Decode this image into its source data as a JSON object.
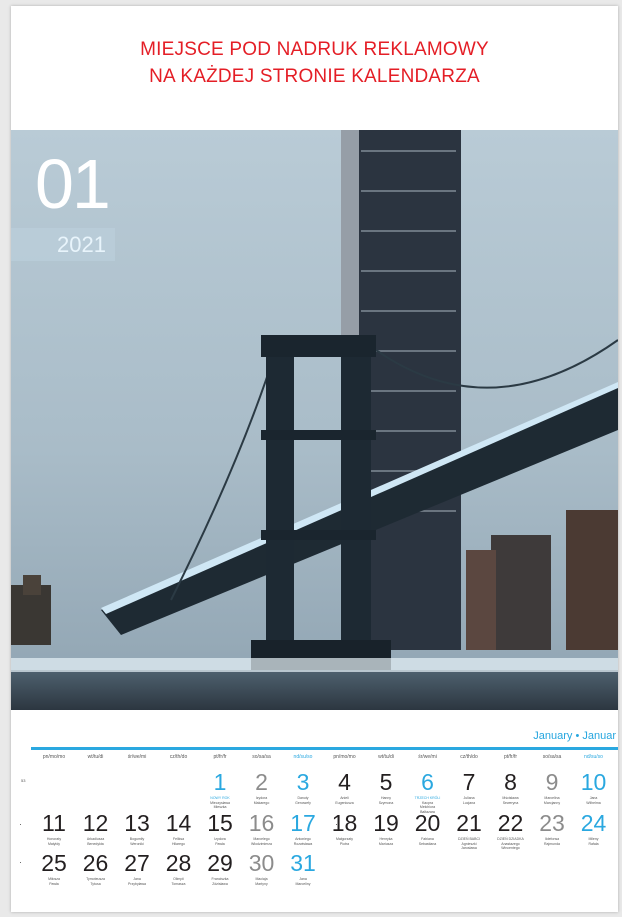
{
  "ad_text": {
    "line1": "MIEJSCE POD NADRUK REKLAMOWY",
    "line2": "NA KAŻDEJ STRONIE KALENDARZA"
  },
  "month_number": "01",
  "year": "2021",
  "month_name": "January • Januar",
  "weekday_headers": [
    "pn/mo/mo",
    "wt/tu/di",
    "śr/we/mi",
    "cz/th/do",
    "pt/fr/fr",
    "so/sa/sa",
    "nd/su/so",
    "pn/mo/mo",
    "wt/tu/di",
    "śr/we/mi",
    "cz/th/do",
    "pt/fr/fr",
    "so/sa/sa",
    "nd/su/so"
  ],
  "week_number": "53",
  "days": [
    {
      "n": "1",
      "names": [
        "NOWY ROK",
        "Mieczysława",
        "Mieszka"
      ],
      "holiday": true
    },
    {
      "n": "2",
      "names": [
        "Izydora",
        "Makarego"
      ]
    },
    {
      "n": "3",
      "names": [
        "Danuty",
        "Genowefy"
      ]
    },
    {
      "n": "4",
      "names": [
        "Anieli",
        "Eugeniusza"
      ]
    },
    {
      "n": "5",
      "names": [
        "Hanny",
        "Szymona"
      ]
    },
    {
      "n": "6",
      "names": [
        "TRZECH KRÓLI",
        "Kacpra",
        "Melchiora",
        "Baltazara"
      ],
      "holiday": true
    },
    {
      "n": "7",
      "names": [
        "Juliana",
        "Lucjana"
      ]
    },
    {
      "n": "8",
      "names": [
        "Mścisława",
        "Seweryna"
      ]
    },
    {
      "n": "9",
      "names": [
        "Marcelina",
        "Marcjanny"
      ]
    },
    {
      "n": "10",
      "names": [
        "Jana",
        "Wilhelma"
      ]
    },
    {
      "n": "11",
      "names": [
        "Honoraty",
        "Matyldy"
      ]
    },
    {
      "n": "12",
      "names": [
        "Arkadiusza",
        "Benedykta"
      ]
    },
    {
      "n": "13",
      "names": [
        "Bogumiły",
        "Weroniki"
      ]
    },
    {
      "n": "14",
      "names": [
        "Feliksa",
        "Hilarego"
      ]
    },
    {
      "n": "15",
      "names": [
        "Izydora",
        "Pawła"
      ]
    },
    {
      "n": "16",
      "names": [
        "Marcelego",
        "Włodzimierza"
      ]
    },
    {
      "n": "17",
      "names": [
        "Antoniego",
        "Rozwisława"
      ]
    },
    {
      "n": "18",
      "names": [
        "Małgorzaty",
        "Piotra"
      ]
    },
    {
      "n": "19",
      "names": [
        "Henryka",
        "Mariusza"
      ]
    },
    {
      "n": "20",
      "names": [
        "Fabiana",
        "Sebastiana"
      ]
    },
    {
      "n": "21",
      "names": [
        "DZIEŃ BABCI",
        "Agnieszki",
        "Jarosława"
      ]
    },
    {
      "n": "22",
      "names": [
        "DZIEŃ DZIADKA",
        "Anastazego",
        "Wincentego"
      ]
    },
    {
      "n": "23",
      "names": [
        "Ildefonsa",
        "Rajmunda"
      ]
    },
    {
      "n": "24",
      "names": [
        "Mileny",
        "Rafała"
      ]
    },
    {
      "n": "25",
      "names": [
        "Miłosza",
        "Pawła"
      ]
    },
    {
      "n": "26",
      "names": [
        "Tymoteusza",
        "Tytusa"
      ]
    },
    {
      "n": "27",
      "names": [
        "Jana",
        "Przybyława"
      ]
    },
    {
      "n": "28",
      "names": [
        "Olimpii",
        "Tomasza"
      ]
    },
    {
      "n": "29",
      "names": [
        "Franciszka",
        "Zdzisława"
      ]
    },
    {
      "n": "30",
      "names": [
        "Maciaja",
        "Martyny"
      ]
    },
    {
      "n": "31",
      "names": [
        "Jana",
        "Marceliny"
      ]
    }
  ],
  "colors": {
    "ad_red": "#e41e26",
    "accent_blue": "#2aa8e0",
    "saturday_grey": "#8c8c8c"
  }
}
